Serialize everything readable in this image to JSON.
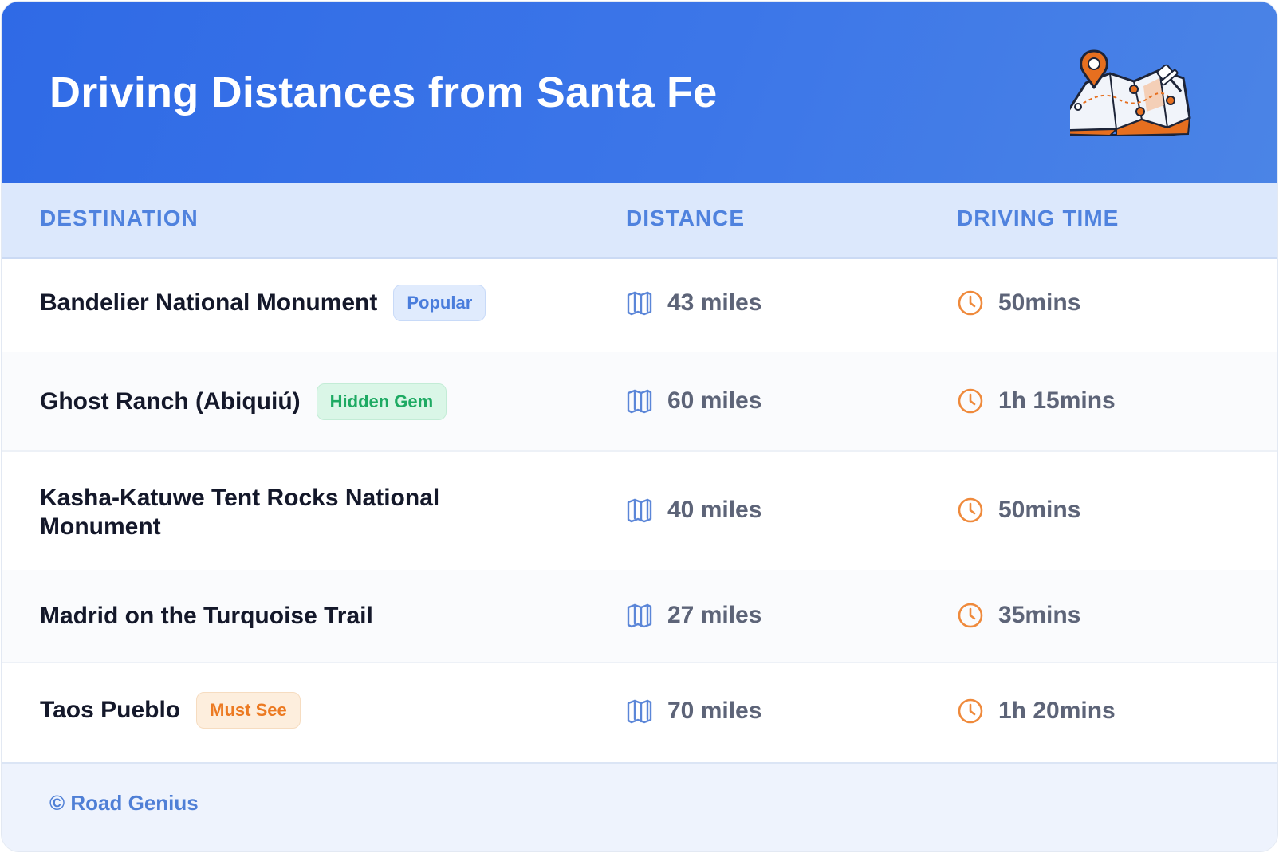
{
  "header": {
    "title": "Driving Distances from Santa Fe",
    "illustration_icon": "folded-map-with-pins-icon"
  },
  "columns": {
    "destination": "DESTINATION",
    "distance": "DISTANCE",
    "driving_time": "DRIVING TIME"
  },
  "rows": [
    {
      "destination": "Bandelier National Monument",
      "badge": "Popular",
      "badge_color": "#4a7ddc",
      "distance": "43 miles",
      "time": "50mins"
    },
    {
      "destination": "Ghost Ranch (Abiquiú)",
      "badge": "Hidden Gem",
      "badge_color": "#1eaa63",
      "distance": "60 miles",
      "time": "1h 15mins"
    },
    {
      "destination": "Kasha-Katuwe Tent Rocks National Monument",
      "badge": "",
      "distance": "40 miles",
      "time": "50mins"
    },
    {
      "destination": "Madrid on the Turquoise Trail",
      "badge": "",
      "distance": "27 miles",
      "time": "35mins"
    },
    {
      "destination": "Taos Pueblo",
      "badge": "Must See",
      "badge_color": "#ec7a22",
      "distance": "70 miles",
      "time": "1h 20mins"
    }
  ],
  "icons": {
    "distance": "map-icon",
    "time": "clock-icon"
  },
  "colors": {
    "header_gradient_start": "#2f6ae6",
    "header_gradient_end": "#4b84e6",
    "column_header_text": "#4f82de",
    "map_icon": "#5b86d8",
    "clock_icon": "#ef8a3c"
  },
  "footer": {
    "copyright": "© Road Genius"
  }
}
